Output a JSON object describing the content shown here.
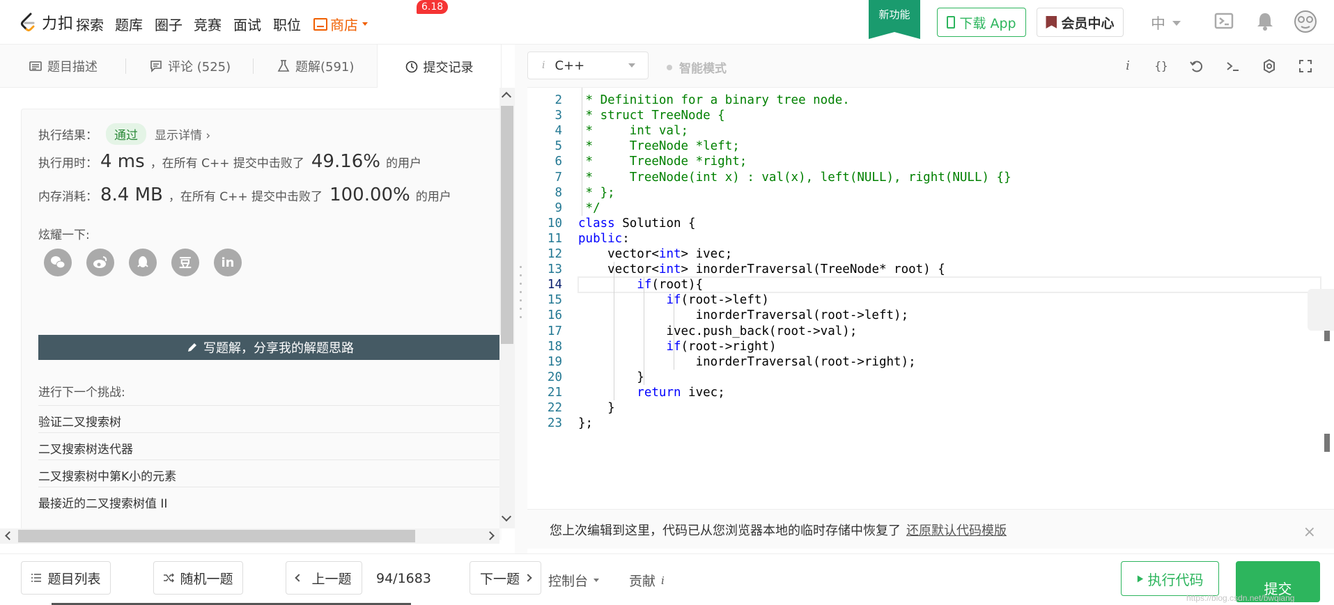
{
  "header": {
    "logo_text": "力扣",
    "nav": [
      "探索",
      "题库",
      "圈子",
      "竞赛",
      "面试",
      "职位"
    ],
    "shop_label": "商店",
    "shop_badge": "6.18",
    "new_feature": "新功能",
    "download_app": "下载 App",
    "vip_center": "会员中心",
    "language": "中"
  },
  "tabs": [
    {
      "label": "题目描述",
      "icon": "description-icon"
    },
    {
      "label": "评论 (525)",
      "icon": "comment-icon"
    },
    {
      "label": "题解(591)",
      "icon": "flask-icon"
    },
    {
      "label": "提交记录",
      "icon": "clock-icon",
      "active": true
    }
  ],
  "result": {
    "exec_label": "执行结果：",
    "status": "通过",
    "detail": "显示详情 ›",
    "time_label": "执行用时：",
    "time_value": "4 ms",
    "time_mid": "，在所有 C++ 提交中击败了",
    "time_pct": "49.16%",
    "time_tail": "的用户",
    "mem_label": "内存消耗：",
    "mem_value": "8.4 MB",
    "mem_mid": "，在所有 C++ 提交中击败了",
    "mem_pct": "100.00%",
    "mem_tail": "的用户",
    "share_label": "炫耀一下:",
    "share_buttons": [
      "wechat-icon",
      "weibo-icon",
      "qq-icon",
      "douban-icon",
      "linkedin-icon"
    ],
    "douban_glyph": "豆",
    "linkedin_glyph": "in",
    "write_solution": "写题解，分享我的解题思路",
    "next_label": "进行下一个挑战:",
    "next_items": [
      "验证二叉搜索树",
      "二叉搜索树迭代器",
      "二叉搜索树中第K小的元素",
      "最接近的二叉搜索树值 II"
    ]
  },
  "editor": {
    "language": "C++",
    "language_info": "i",
    "smart_mode": "智能模式",
    "toolbar_icons": [
      "info-icon",
      "braces-icon",
      "reset-icon",
      "terminal-icon",
      "settings-icon",
      "fullscreen-icon"
    ],
    "info_glyph": "i",
    "braces_glyph": "{}",
    "lines": [
      {
        "n": "2",
        "html": "<span class='c-cm'> * Definition for a binary tree node.</span>"
      },
      {
        "n": "3",
        "html": "<span class='c-cm'> * struct TreeNode {</span>"
      },
      {
        "n": "4",
        "html": "<span class='c-cm'> *     int val;</span>"
      },
      {
        "n": "5",
        "html": "<span class='c-cm'> *     TreeNode *left;</span>"
      },
      {
        "n": "6",
        "html": "<span class='c-cm'> *     TreeNode *right;</span>"
      },
      {
        "n": "7",
        "html": "<span class='c-cm'> *     TreeNode(int x) : val(x), left(NULL), right(NULL) {}</span>"
      },
      {
        "n": "8",
        "html": "<span class='c-cm'> * };</span>"
      },
      {
        "n": "9",
        "html": "<span class='c-cm'> */</span>"
      },
      {
        "n": "10",
        "html": "<span class='c-kw'>class</span> Solution {"
      },
      {
        "n": "11",
        "html": "<span class='c-kw'>public</span>:"
      },
      {
        "n": "12",
        "html": "    vector&lt;<span class='c-kw'>int</span>&gt; ivec;"
      },
      {
        "n": "13",
        "html": "    vector&lt;<span class='c-kw'>int</span>&gt; inorderTraversal(TreeNode* root) {"
      },
      {
        "n": "14",
        "html": "        <span class='c-kw'>if</span>(root){"
      },
      {
        "n": "15",
        "html": "            <span class='c-kw'>if</span>(root-&gt;left)"
      },
      {
        "n": "16",
        "html": "                inorderTraversal(root-&gt;left);"
      },
      {
        "n": "17",
        "html": "            ivec.push_back(root-&gt;val);"
      },
      {
        "n": "18",
        "html": "            <span class='c-kw'>if</span>(root-&gt;right)"
      },
      {
        "n": "19",
        "html": "                inorderTraversal(root-&gt;right);"
      },
      {
        "n": "20",
        "html": "        }"
      },
      {
        "n": "21",
        "html": "        <span class='c-kw'>return</span> ivec;"
      },
      {
        "n": "22",
        "html": "    }"
      },
      {
        "n": "23",
        "html": "};"
      }
    ],
    "current_line": "14",
    "restore_msg": "您上次编辑到这里，代码已从您浏览器本地的临时存储中恢复了",
    "restore_link": "还原默认代码模版",
    "close_glyph": "×"
  },
  "bottom": {
    "problem_list": "题目列表",
    "random": "随机一题",
    "prev": "上一题",
    "pager": "94/1683",
    "next": "下一题",
    "console": "控制台",
    "contribute": "贡献",
    "contribute_info": "i",
    "run": "执行代码",
    "submit": "提交",
    "watermark": "https://blog.csdn.net/bwqiang"
  },
  "colors": {
    "brand_green": "#2db55d",
    "shop_orange": "#f05f00",
    "badge_red": "#f53434",
    "new_feature_green": "#1a9b6e",
    "write_btn": "#455a64"
  }
}
